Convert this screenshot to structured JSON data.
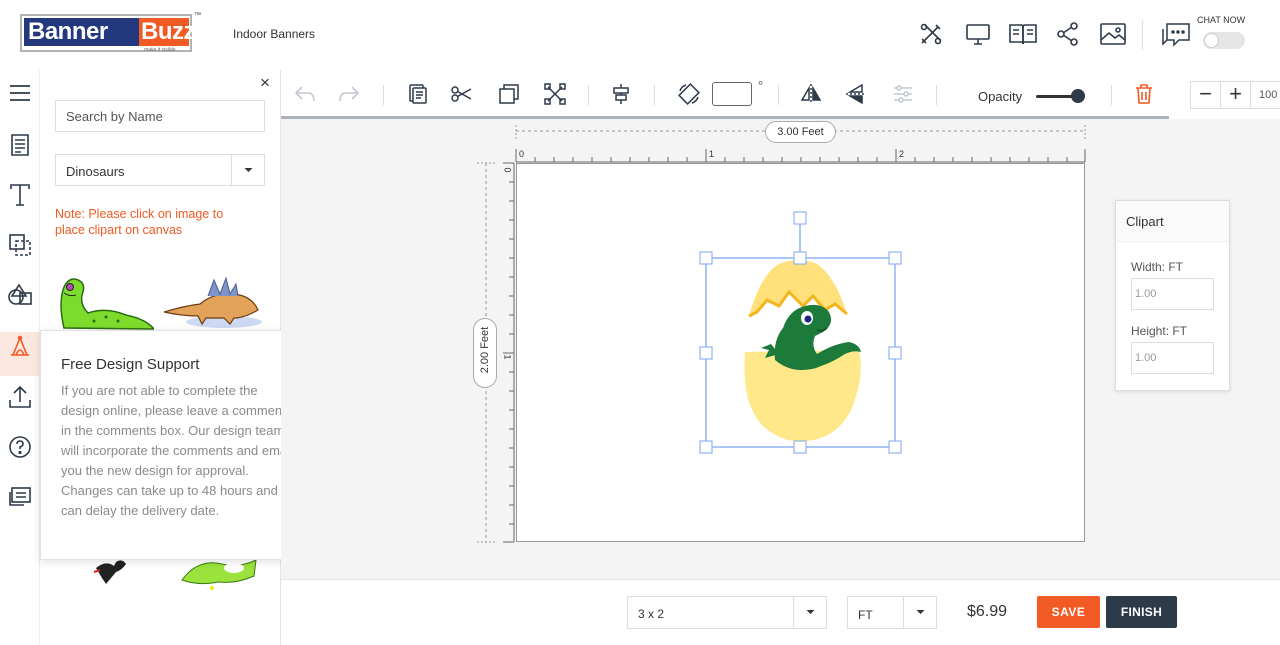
{
  "brand": {
    "word1": "Banner",
    "word2": "Buzz",
    "tm": "™",
    "tagline": "make it visible"
  },
  "header": {
    "title": "Indoor Banners",
    "icons": [
      "tools-icon",
      "desktop-icon",
      "book-icon",
      "share-icon",
      "image-icon"
    ],
    "chat_label": "CHAT NOW",
    "chat_enabled": false
  },
  "rail": {
    "icons": [
      "menu-icon",
      "template-icon",
      "text-icon",
      "layers-icon",
      "shapes-icon",
      "clipart-icon",
      "upload-icon",
      "help-icon",
      "comments-icon"
    ],
    "active": "clipart-icon"
  },
  "panel": {
    "close_glyph": "×",
    "search_placeholder": "Search by Name",
    "category": "Dinosaurs",
    "note": "Note: Please click on image to place clipart on canvas"
  },
  "popup": {
    "title": "Free Design Support",
    "close_glyph": "×",
    "body": "If you are not able to complete the design online, please leave a comments in the comments box. Our design team will incorporate the comments and email you the new design for approval. Changes can take up to 48 hours and can delay the delivery date."
  },
  "toolbar": {
    "degree": "°",
    "opacity_label": "Opacity",
    "opacity_value": 1.0,
    "zoom_minus": "−",
    "zoom_plus": "+",
    "zoom_value": "100"
  },
  "canvas": {
    "width_label": "3.00 Feet",
    "height_label": "2.00 Feet",
    "ruler_top": [
      "0",
      "1",
      "2"
    ],
    "ruler_left": [
      "0",
      "1"
    ]
  },
  "clipart_panel": {
    "title": "Clipart",
    "width_label": "Width: FT",
    "width_value": "1.00",
    "height_label": "Height: FT",
    "height_value": "1.00"
  },
  "footer": {
    "size": "3 x 2",
    "unit": "FT",
    "price": "$6.99",
    "save": "SAVE",
    "finish": "FINISH"
  },
  "colors": {
    "brand_blue": "#24397d",
    "brand_orange": "#f15a22",
    "dark": "#2d3a4a"
  }
}
